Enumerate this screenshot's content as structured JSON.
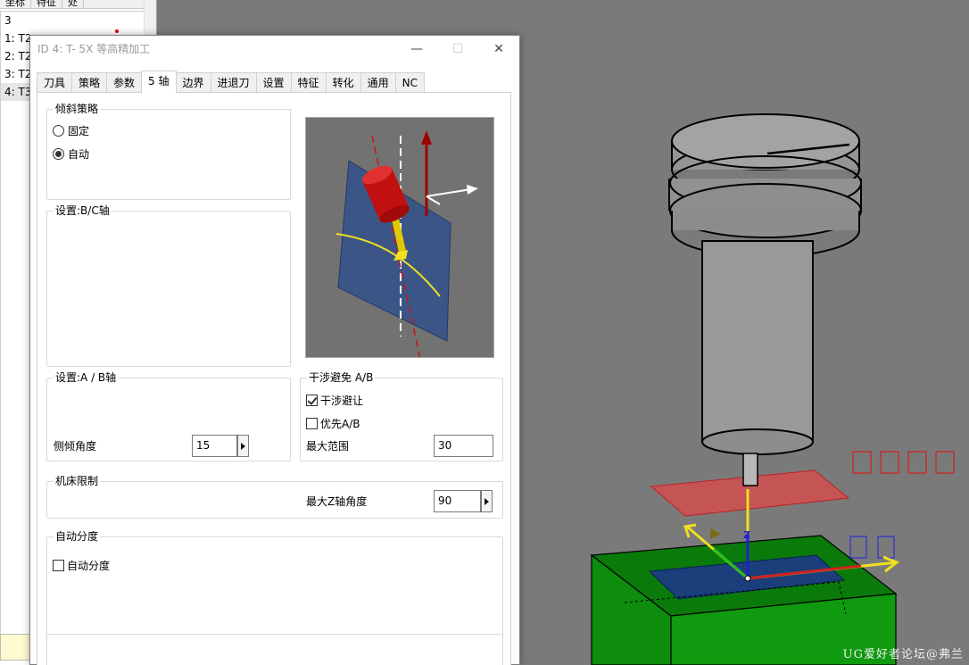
{
  "background_panel": {
    "headers": [
      "坐标",
      "特征",
      "处"
    ],
    "group_label": "3",
    "rows": [
      "1: T2",
      "2: T2",
      "3: T2",
      "4: T3"
    ]
  },
  "dialog": {
    "title": "ID 4: T- 5X 等高精加工",
    "window_buttons": {
      "minimize": "—",
      "maximize": "☐",
      "close": "✕"
    },
    "tabs": [
      "刀具",
      "策略",
      "参数",
      "5 轴",
      "边界",
      "进退刀",
      "设置",
      "特征",
      "转化",
      "通用",
      "NC"
    ],
    "active_tab": "5 轴",
    "tilt_strategy": {
      "title": "倾斜策略",
      "options": [
        {
          "label": "固定",
          "selected": false
        },
        {
          "label": "自动",
          "selected": true
        }
      ]
    },
    "bc_axis": {
      "title": "设置:B/C轴"
    },
    "ab_axis": {
      "title": "设置:A  / B轴",
      "side_tilt_label": "侧倾角度",
      "side_tilt_value": "15"
    },
    "collision": {
      "title": "干涉避免 A/B",
      "avoid_label": "干涉避让",
      "avoid_checked": true,
      "prefer_label": "优先A/B",
      "prefer_checked": false,
      "max_range_label": "最大范围",
      "max_range_value": "30"
    },
    "machine_limit": {
      "title": "机床限制",
      "max_z_label": "最大Z轴角度",
      "max_z_value": "90"
    },
    "auto_index": {
      "title": "自动分度",
      "checkbox_label": "自动分度",
      "checked": false
    }
  },
  "viewport": {
    "axis_label": "Z",
    "watermark": "UG爱好者论坛@弗兰"
  }
}
